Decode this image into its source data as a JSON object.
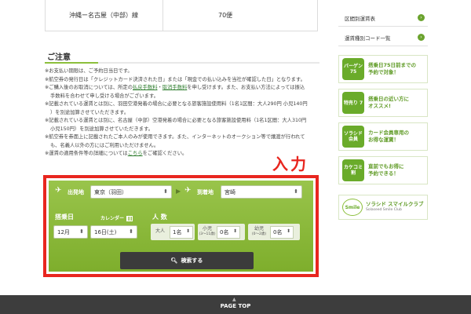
{
  "route_row": {
    "route": "沖縄ー名古屋（中部）線",
    "flights": "70便"
  },
  "notes": {
    "title": "ご注意",
    "lines": [
      "※お支払い期限は、ご予約日当日です。",
      "※航空券の発行日は「クレジットカード決済された日」または「現金での払い込みを当社が確認した日」となります。",
      "※ご購入後のお取消については、所定の",
      "手数料を合わせて申し受ける場合がございます。",
      "※記載されている運賃とは別に、羽田空港発着の場合に必要となる旅客施設使用料（1名1区間：大人290円 小児140円",
      "）を別途加算させていただきます。",
      "※記載されている運賃とは別に、名古屋（中部）空港発着の場合に必要となる旅客施設使用料（1名1区間：大人310円",
      "小児150円）を別途加算させていただきます。",
      "※航空券を券面上に記載されたご本人のみが使用できます。また、インターネットのオークション等で譲渡が行われて",
      "も、名義人以外の方にはご利用いただけません。",
      "※運賃の適用条件等の詳細については"
    ],
    "link_refund": "払戻手数料",
    "sep": "・",
    "link_cancel": "取消手数料",
    "after_links": "を申し受けます。また、お支払い方法によっては振込",
    "link_here": "こちら",
    "after_here": "をご確認ください。"
  },
  "annotation_label": "入力",
  "search": {
    "depart_label": "出発地",
    "depart_value": "東京（羽田）",
    "arrive_label": "到着地",
    "arrive_value": "宮崎",
    "date_label": "搭乗日",
    "calendar_label": "カレンダー",
    "month_value": "12月",
    "day_value": "16日(土)",
    "pax_label": "人 数",
    "adult_label": "大人",
    "adult_value": "1名",
    "child_label": "小児",
    "child_sub": "(3〜11歳)",
    "child_value": "0名",
    "infant_label": "幼児",
    "infant_sub": "(0〜2歳)",
    "infant_value": "0名",
    "search_button": "検索する"
  },
  "sidebar": {
    "links": [
      {
        "label": "区間別運賃表"
      },
      {
        "label": "運賃種別コード一覧"
      }
    ],
    "banners": [
      {
        "badge": "バーゲン 75",
        "text_1": "搭乗日75日前までの",
        "text_2": "予約で対象！"
      },
      {
        "badge": "特売り 7",
        "text_1": "搭乗日の近い方に",
        "text_2": "オススメ!"
      },
      {
        "badge": "ソラシド 会員",
        "text_1": "カード会員専用の",
        "text_2": "お得な運賃！"
      },
      {
        "badge": "カケコミ 割",
        "text_1": "直前でもお得に",
        "text_2": "予約できる！"
      }
    ],
    "smile": {
      "logo": "Smile",
      "title": "ソラシド スマイルクラブ",
      "sub": "Solaseed Smile Club"
    }
  },
  "footer": {
    "page_top": "PAGE TOP"
  }
}
